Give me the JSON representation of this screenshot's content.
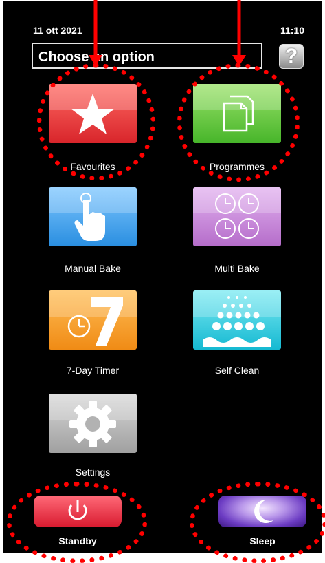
{
  "status": {
    "date": "11 ott 2021",
    "time": "11:10"
  },
  "header": {
    "title": "Choose an option",
    "help_label": "?"
  },
  "tiles": [
    {
      "label": "Favourites",
      "icon": "star-icon",
      "color": "#e8343a"
    },
    {
      "label": "Programmes",
      "icon": "documents-icon",
      "color": "#5cc43a"
    },
    {
      "label": "Manual Bake",
      "icon": "hand-pointer-icon",
      "color": "#3a9ce6"
    },
    {
      "label": "Multi Bake",
      "icon": "clocks-icon",
      "color": "#c385d8"
    },
    {
      "label": "7-Day Timer",
      "icon": "seven-timer-icon",
      "color": "#f59a24"
    },
    {
      "label": "Self Clean",
      "icon": "water-spray-icon",
      "color": "#22c3d8"
    },
    {
      "label": "Settings",
      "icon": "gear-icon",
      "color": "#b8b8b8"
    }
  ],
  "bottom": {
    "standby_label": "Standby",
    "sleep_label": "Sleep"
  },
  "colors": {
    "annotation": "#ff0000",
    "screen_bg": "#000000"
  }
}
